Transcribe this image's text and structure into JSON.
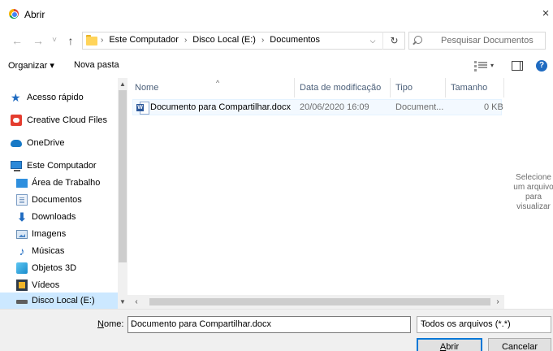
{
  "window": {
    "title": "Abrir",
    "close": "×"
  },
  "nav": {
    "back": "←",
    "forward": "→",
    "history": "˅",
    "up": "↑"
  },
  "address": {
    "crumbs": [
      "Este Computador",
      "Disco Local (E:)",
      "Documentos"
    ],
    "separator": "›",
    "dropdown": "⌵",
    "refresh": "↻"
  },
  "search": {
    "placeholder": "Pesquisar Documentos"
  },
  "toolbar": {
    "organize": "Organizar ▾",
    "new_folder": "Nova pasta",
    "view_caret": "▾",
    "help": "?"
  },
  "navpane": {
    "items": [
      {
        "label": "Acesso rápido",
        "icon": "quick-access-star-icon"
      },
      {
        "label": "Creative Cloud Files",
        "icon": "creative-cloud-icon"
      },
      {
        "label": "OneDrive",
        "icon": "onedrive-cloud-icon"
      },
      {
        "label": "Este Computador",
        "icon": "computer-icon"
      },
      {
        "label": "Área de Trabalho",
        "icon": "desktop-icon"
      },
      {
        "label": "Documentos",
        "icon": "documents-icon"
      },
      {
        "label": "Downloads",
        "icon": "downloads-icon"
      },
      {
        "label": "Imagens",
        "icon": "pictures-icon"
      },
      {
        "label": "Músicas",
        "icon": "music-icon"
      },
      {
        "label": "Objetos 3D",
        "icon": "3d-objects-icon"
      },
      {
        "label": "Vídeos",
        "icon": "videos-icon"
      },
      {
        "label": "Disco Local (E:)",
        "icon": "drive-icon"
      }
    ],
    "selected": "Disco Local (E:)"
  },
  "filelist": {
    "columns": [
      "Nome",
      "Data de modificação",
      "Tipo",
      "Tamanho"
    ],
    "rows": [
      {
        "name": "Documento para Compartilhar.docx",
        "modified": "20/06/2020 16:09",
        "type": "Document...",
        "size": "0 KB"
      }
    ]
  },
  "preview": {
    "message": "Selecione\num arquivo\npara\nvisualizar"
  },
  "bottom": {
    "name_label_mnemonic": "N",
    "name_label_rest": "ome:",
    "filename": "Documento para Compartilhar.docx",
    "filetype": "Todos os arquivos (*.*)",
    "open_mnemonic": "A",
    "open_rest": "brir",
    "cancel": "Cancelar"
  },
  "colors": {
    "accent": "#0078d7",
    "selection": "#cce8ff",
    "header_text": "#4c607a"
  }
}
